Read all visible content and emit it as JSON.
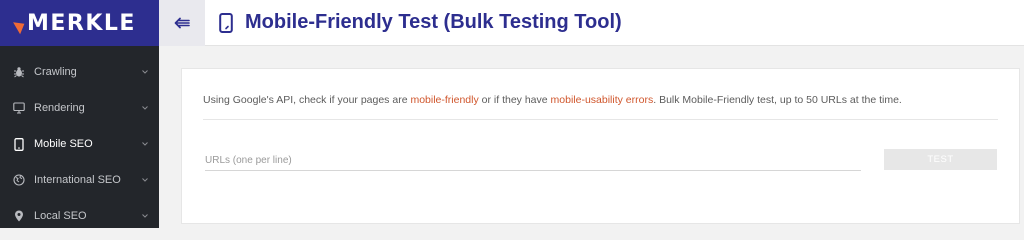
{
  "brand": {
    "name": "MERKLE",
    "accent": "#f06a36",
    "header_bg": "#2d2e8f"
  },
  "sidebar": {
    "items": [
      {
        "label": "Crawling",
        "icon": "bug-icon",
        "active": false
      },
      {
        "label": "Rendering",
        "icon": "monitor-icon",
        "active": false
      },
      {
        "label": "Mobile SEO",
        "icon": "phone-icon",
        "active": true
      },
      {
        "label": "International SEO",
        "icon": "globe-icon",
        "active": false
      },
      {
        "label": "Local SEO",
        "icon": "map-pin-icon",
        "active": false
      }
    ]
  },
  "header": {
    "title": "Mobile-Friendly Test (Bulk Testing Tool)",
    "collapse_icon": "collapse-menu-icon",
    "title_icon": "phone-icon"
  },
  "main": {
    "description": {
      "part1": "Using Google's API, check if your pages are ",
      "link1": "mobile-friendly",
      "part2": " or if they have ",
      "link2": "mobile-usability errors",
      "part3": ". Bulk Mobile-Friendly test, up to 50 URLs at the time."
    },
    "url_input": {
      "placeholder": "URLs (one per line)",
      "value": ""
    },
    "test_button": "TEST"
  }
}
